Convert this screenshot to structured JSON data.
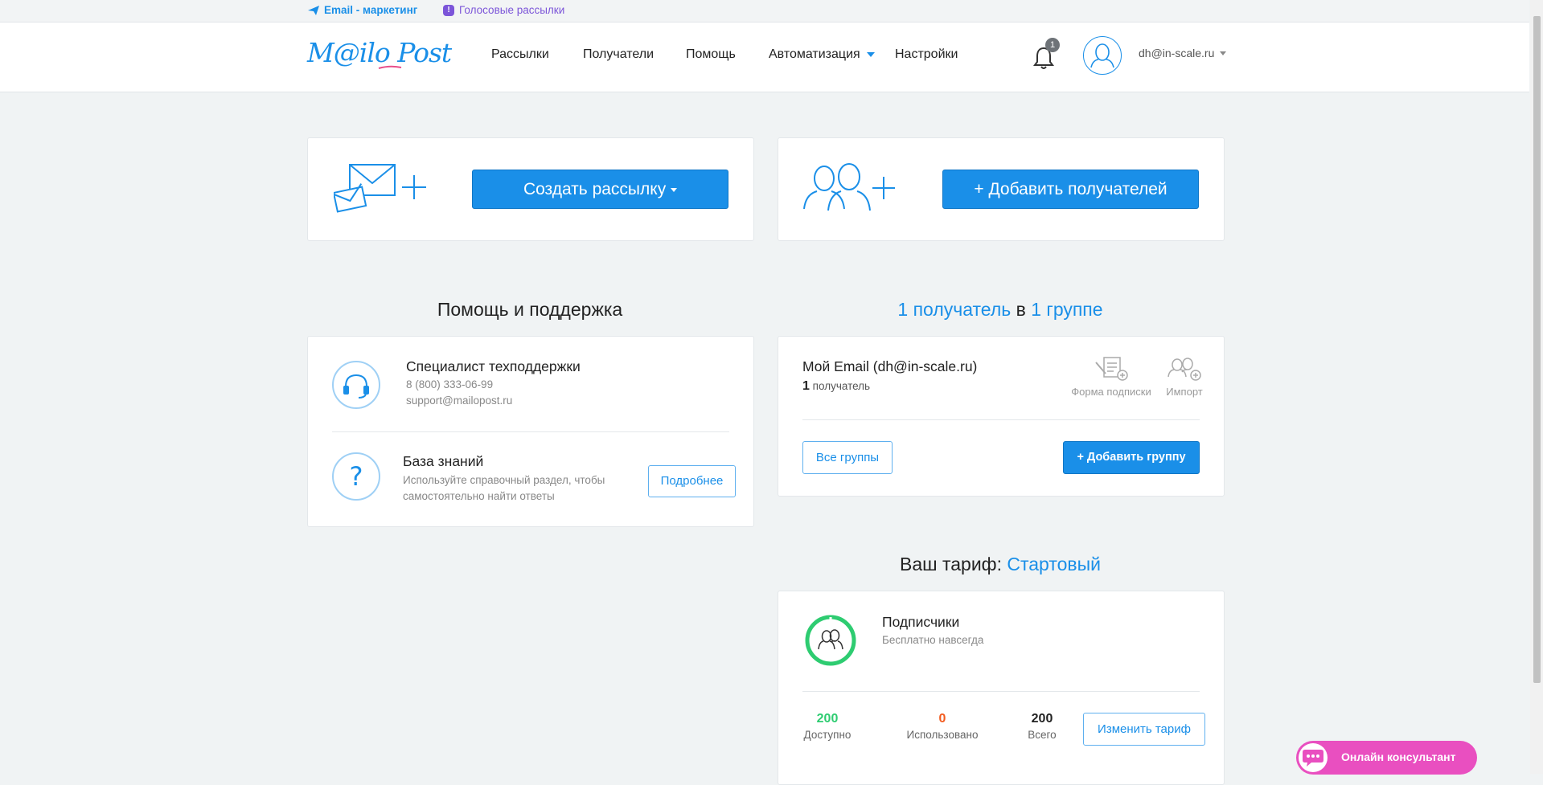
{
  "topbar": {
    "email_marketing": "Email - маркетинг",
    "voice_mailings": "Голосовые рассылки"
  },
  "header": {
    "logo": "M@ilo Post",
    "nav": [
      "Рассылки",
      "Получатели",
      "Помощь",
      "Автоматизация",
      "Настройки"
    ],
    "notifications_count": "1",
    "user_email": "dh@in-scale.ru"
  },
  "actions": {
    "create_mailing": "Создать рассылку",
    "add_recipients": "+ Добавить получателей"
  },
  "help": {
    "title": "Помощь и поддержка",
    "specialist_title": "Специалист техподдержки",
    "phone": "8 (800) 333-06-99",
    "email": "support@mailopost.ru",
    "kb_title": "База знаний",
    "kb_desc_line1": "Используйте справочный раздел, чтобы",
    "kb_desc_line2": "самостоятельно найти ответы",
    "more_button": "Подробнее"
  },
  "recipients": {
    "title_count": "1 получатель",
    "title_in": "в",
    "title_groups": "1 группе",
    "group_name": "Мой Email (dh@in-scale.ru)",
    "group_count": "1",
    "group_count_label": "получатель",
    "subscribe_form": "Форма подписки",
    "import": "Импорт",
    "all_groups": "Все группы",
    "add_group": "+ Добавить группу"
  },
  "tariff": {
    "title_prefix": "Ваш тариф:",
    "plan": "Стартовый",
    "subscribers_title": "Подписчики",
    "subscribers_sub": "Бесплатно навсегда",
    "available_value": "200",
    "available_label": "Доступно",
    "used_value": "0",
    "used_label": "Использовано",
    "total_value": "200",
    "total_label": "Всего",
    "change_button": "Изменить тариф",
    "used_fraction": 0.0
  },
  "chat": {
    "label": "Онлайн консультант"
  },
  "colors": {
    "accent": "#1a8fe8",
    "green": "#2ecc71",
    "orange": "#f25b1f",
    "chat": "#e94fc0"
  }
}
